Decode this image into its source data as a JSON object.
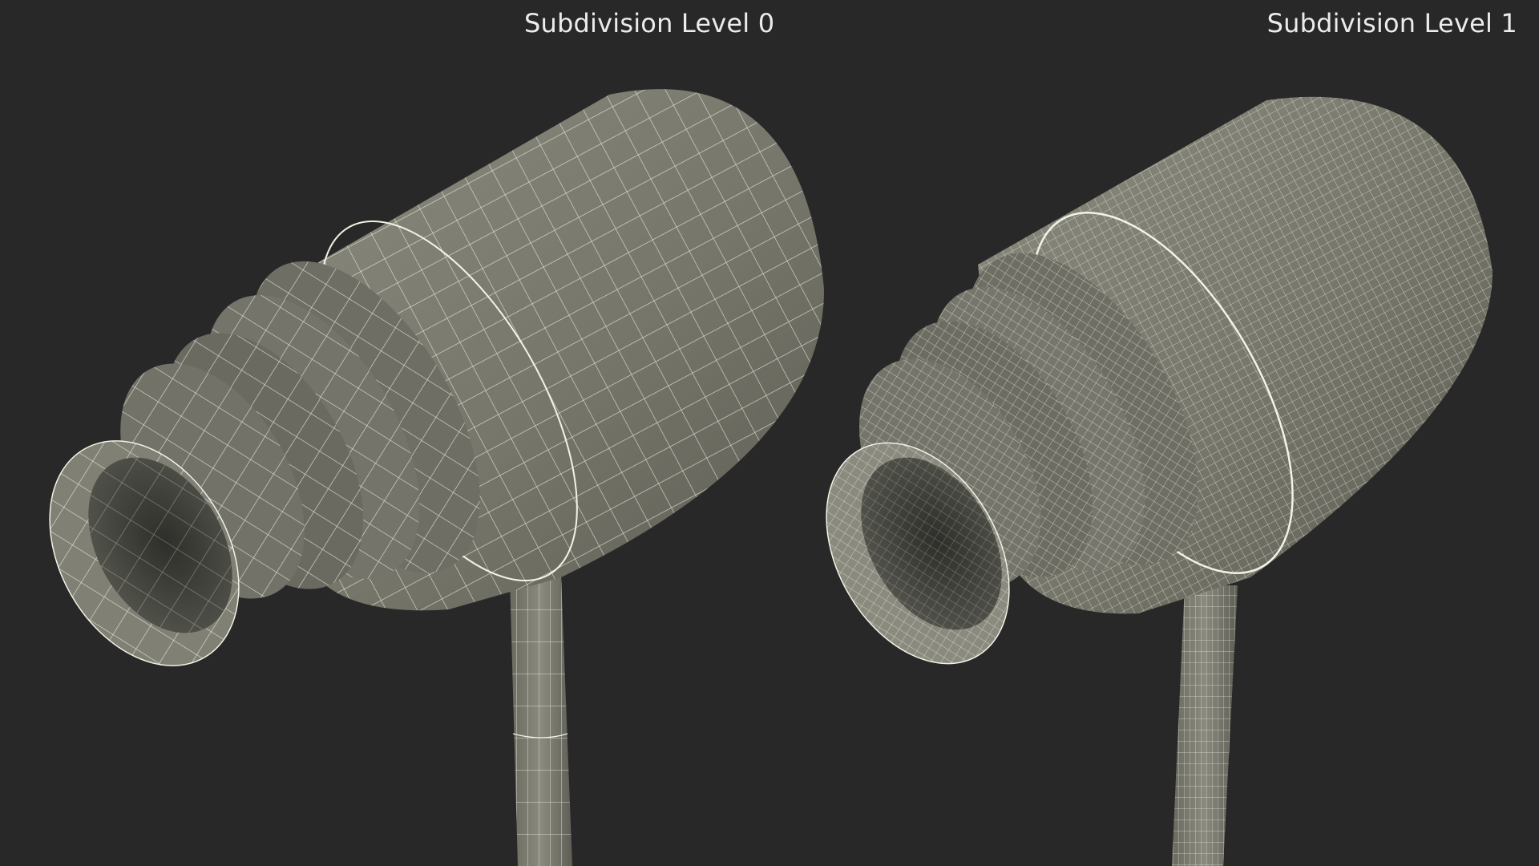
{
  "panels": {
    "left": {
      "label": "Subdivision Level 0"
    },
    "right": {
      "label": "Subdivision Level 1"
    }
  },
  "colors": {
    "background": "#282828",
    "surface": "#7c7c70",
    "surface_shadow": "#5a5a52",
    "surface_highlight": "#9a9a8c",
    "wire": "#f2f2e6",
    "inner": "#3e3e38"
  }
}
